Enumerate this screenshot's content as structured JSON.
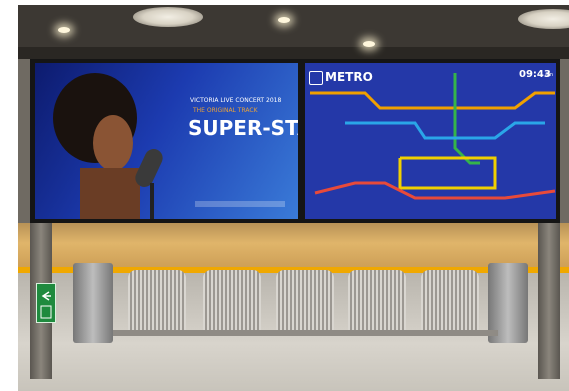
{
  "concert": {
    "headline": "VICTORIA LIVE CONCERT 2018",
    "subtitle": "THE ORIGINAL TRACK",
    "title": "SUPER-STAR"
  },
  "metro": {
    "logo_text": "METRO",
    "time": "09:43",
    "time_suffix": "am",
    "line_colors": [
      "#f0a000",
      "#35b44a",
      "#f0d000",
      "#e84a3a",
      "#2aa6e8"
    ]
  }
}
